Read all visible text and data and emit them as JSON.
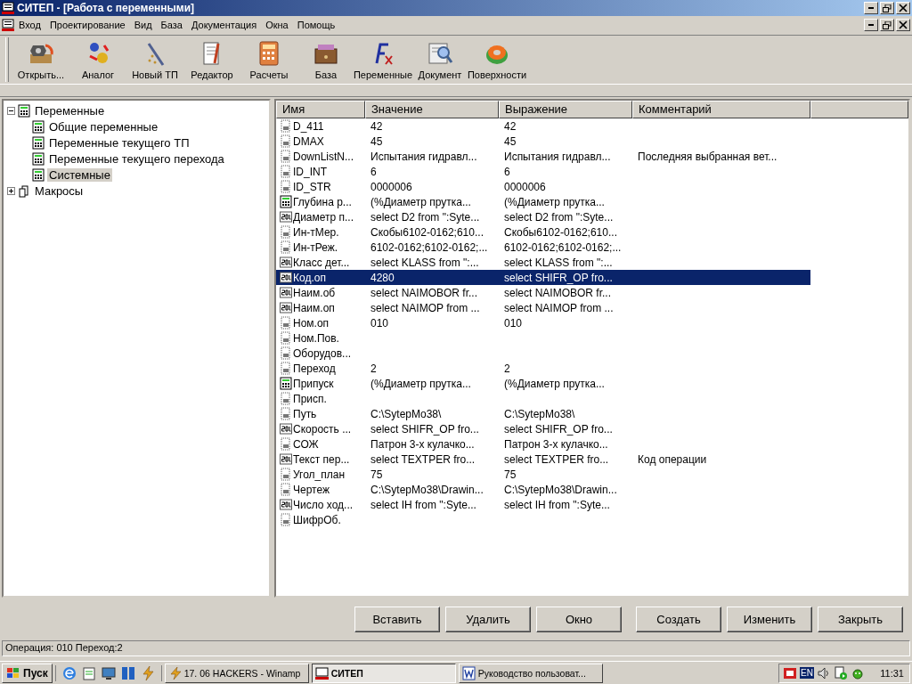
{
  "window": {
    "title": "СИТЕП - [Работа с переменными]"
  },
  "menu": [
    "Вход",
    "Проектирование",
    "Вид",
    "База",
    "Документация",
    "Окна",
    "Помощь"
  ],
  "toolbar": [
    {
      "label": "Открыть..."
    },
    {
      "label": "Аналог"
    },
    {
      "label": "Новый ТП"
    },
    {
      "label": "Редактор"
    },
    {
      "label": "Расчеты"
    },
    {
      "label": "База"
    },
    {
      "label": "Переменные"
    },
    {
      "label": "Документ"
    },
    {
      "label": "Поверхности"
    }
  ],
  "tree": [
    {
      "label": "Переменные",
      "expanded": true,
      "selected": false,
      "children": [
        {
          "label": "Общие переменные",
          "selected": false
        },
        {
          "label": "Переменные текущего ТП",
          "selected": false
        },
        {
          "label": "Переменные текущего перехода",
          "selected": false
        },
        {
          "label": "Системные",
          "selected": true
        }
      ]
    },
    {
      "label": "Макросы",
      "expanded": false,
      "selected": false
    }
  ],
  "table": {
    "columns": [
      "Имя",
      "Значение",
      "Выражение",
      "Комментарий"
    ],
    "rows": [
      {
        "kind": "doc",
        "selected": false,
        "cells": [
          "D_411",
          "42",
          "42",
          ""
        ]
      },
      {
        "kind": "doc",
        "selected": false,
        "cells": [
          "DMAX",
          "45",
          "45",
          ""
        ]
      },
      {
        "kind": "doc",
        "selected": false,
        "cells": [
          "DownListN...",
          "Испытания гидравл...",
          "Испытания гидравл...",
          "Последняя выбранная вет..."
        ]
      },
      {
        "kind": "doc",
        "selected": false,
        "cells": [
          "ID_INT",
          "6",
          "6",
          ""
        ]
      },
      {
        "kind": "doc",
        "selected": false,
        "cells": [
          "ID_STR",
          "0000006",
          "0000006",
          ""
        ]
      },
      {
        "kind": "calc",
        "selected": false,
        "cells": [
          "Глубина р...",
          "(%Диаметр прутка...",
          "(%Диаметр прутка...",
          ""
        ]
      },
      {
        "kind": "sql",
        "selected": false,
        "cells": [
          "Диаметр п...",
          "select D2  from \":Syte...",
          "select D2  from \":Syte...",
          ""
        ]
      },
      {
        "kind": "doc",
        "selected": false,
        "cells": [
          "Ин-тМер.",
          "Скобы6102-0162;610...",
          "Скобы6102-0162;610...",
          ""
        ]
      },
      {
        "kind": "doc",
        "selected": false,
        "cells": [
          "Ин-тРеж.",
          "6102-0162;6102-0162;...",
          "6102-0162;6102-0162;...",
          ""
        ]
      },
      {
        "kind": "sql",
        "selected": false,
        "cells": [
          "Класс дет...",
          "select KLASS from \":...",
          "select KLASS from \":...",
          ""
        ]
      },
      {
        "kind": "sql",
        "selected": true,
        "cells": [
          "Код.оп",
          "4280",
          "select SHIFR_OP  fro...",
          ""
        ]
      },
      {
        "kind": "sql",
        "selected": false,
        "cells": [
          "Наим.об",
          "select NAIMOBOR  fr...",
          "select NAIMOBOR  fr...",
          ""
        ]
      },
      {
        "kind": "sql",
        "selected": false,
        "cells": [
          "Наим.оп",
          "select NAIMOP  from ...",
          "select NAIMOP  from ...",
          ""
        ]
      },
      {
        "kind": "doc",
        "selected": false,
        "cells": [
          "Ном.оп",
          "010",
          "010",
          ""
        ]
      },
      {
        "kind": "doc",
        "selected": false,
        "cells": [
          "Ном.Пов.",
          "",
          "",
          ""
        ]
      },
      {
        "kind": "doc",
        "selected": false,
        "cells": [
          "Оборудов...",
          "",
          "",
          ""
        ]
      },
      {
        "kind": "doc",
        "selected": false,
        "cells": [
          "Переход",
          "2",
          "2",
          ""
        ]
      },
      {
        "kind": "calc",
        "selected": false,
        "cells": [
          "Припуск",
          "(%Диаметр прутка...",
          "(%Диаметр прутка...",
          ""
        ]
      },
      {
        "kind": "doc",
        "selected": false,
        "cells": [
          "Присп.",
          "",
          "",
          ""
        ]
      },
      {
        "kind": "doc",
        "selected": false,
        "cells": [
          "Путь",
          "C:\\SytepMo38\\",
          "C:\\SytepMo38\\",
          ""
        ]
      },
      {
        "kind": "sql",
        "selected": false,
        "cells": [
          "Скорость ...",
          "select SHIFR_OP  fro...",
          "select SHIFR_OP  fro...",
          ""
        ]
      },
      {
        "kind": "doc",
        "selected": false,
        "cells": [
          "СОЖ",
          "Патрон 3-х кулачко...",
          "Патрон 3-х кулачко...",
          ""
        ]
      },
      {
        "kind": "sql",
        "selected": false,
        "cells": [
          "Текст пер...",
          "select TEXTPER  fro...",
          "select TEXTPER  fro...",
          "Код операции"
        ]
      },
      {
        "kind": "doc",
        "selected": false,
        "cells": [
          "Угол_план",
          "75",
          "75",
          ""
        ]
      },
      {
        "kind": "doc",
        "selected": false,
        "cells": [
          "Чертеж",
          "C:\\SytepMo38\\Drawin...",
          "C:\\SytepMo38\\Drawin...",
          ""
        ]
      },
      {
        "kind": "sql",
        "selected": false,
        "cells": [
          "Число ход...",
          "select IH  from \":Syte...",
          "select IH  from \":Syte...",
          ""
        ]
      },
      {
        "kind": "doc",
        "selected": false,
        "cells": [
          "ШифрОб.",
          "",
          "",
          ""
        ]
      }
    ]
  },
  "buttons": [
    "Вставить",
    "Удалить",
    "Окно",
    "Создать",
    "Изменить",
    "Закрыть"
  ],
  "status_bar": "Операция: 010 Переход:2",
  "taskbar": {
    "start": "Пуск",
    "tasks": [
      {
        "label": "17. 06 HACKERS - Winamp",
        "selected": false
      },
      {
        "label": "СИТЕП",
        "selected": true
      },
      {
        "label": "Руководство пользоват...",
        "selected": false
      }
    ],
    "language": "EN",
    "clock": "11:31"
  }
}
